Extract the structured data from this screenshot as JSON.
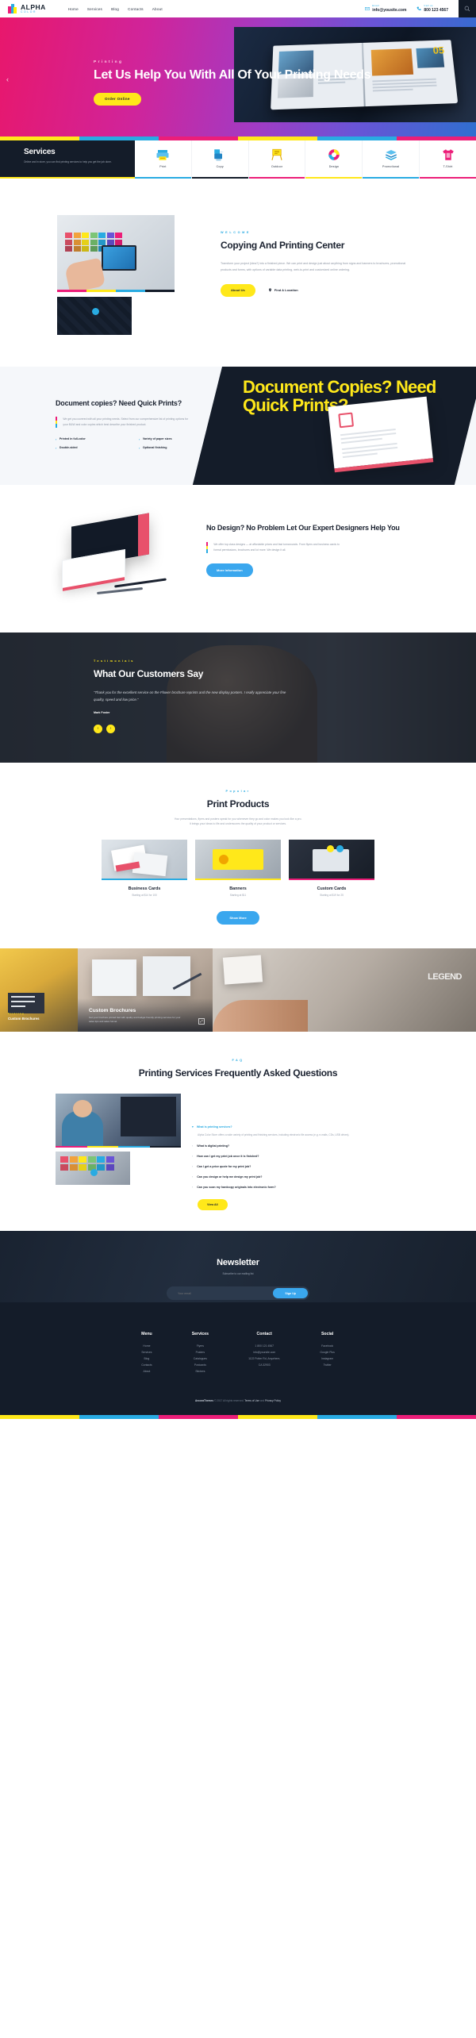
{
  "header": {
    "logo_title": "ALPHA",
    "logo_sub": "COLOR",
    "nav": [
      {
        "label": "Home"
      },
      {
        "label": "Services"
      },
      {
        "label": "Blog"
      },
      {
        "label": "Contacts"
      },
      {
        "label": "About"
      }
    ],
    "email_label": "Email",
    "email_value": "info@yousite.com",
    "phone_label": "Call us",
    "phone_value": "800 123 4567",
    "search_icon": "search-icon"
  },
  "hero": {
    "eyebrow": "Printing",
    "title": "Let Us Help You With All Of Your Printing Needs",
    "button": "Order Online",
    "prev_arrow": "‹",
    "book_number": "05"
  },
  "services": {
    "title": "Services",
    "subtitle": "Online and in store, you can find printing services to help you get the job done.",
    "items": [
      {
        "label": "Print",
        "icon": "printer-icon",
        "accent": "#29abe2"
      },
      {
        "label": "Copy",
        "icon": "copier-icon",
        "accent": "#141c29"
      },
      {
        "label": "Outdoor",
        "icon": "sign-board-icon",
        "accent": "#ec1e79"
      },
      {
        "label": "Design",
        "icon": "color-wheel-icon",
        "accent": "#ffe81a"
      },
      {
        "label": "Promotional",
        "icon": "stack-paper-icon",
        "accent": "#29abe2"
      },
      {
        "label": "T-Shirt",
        "icon": "tshirt-icon",
        "accent": "#ec1e79"
      }
    ]
  },
  "welcome": {
    "eyebrow": "Welcome",
    "title": "Copying And Printing Center",
    "paragraph": "Transform your project (idea?) into a finished piece. We can print and design just about anything from signs and banners to brochures, promotional products and forms, with options of variable data printing, web-to-print and customized online ordering.",
    "primary_button": "About Us",
    "secondary_link": "Find A Location",
    "location_icon": "map-pin-icon"
  },
  "document": {
    "title": "Document copies? Need Quick Prints?",
    "ghost_text": "Document Copies? Need Quick Prints?",
    "paragraph": "We get you covered with all your printing needs. Select from our comprehensive list of printing options for your B&W and color copies which best describe your finished product.",
    "features": [
      "Printed in full-color",
      "Variety of paper sizes",
      "Double-sided",
      "Optional finishing"
    ]
  },
  "design": {
    "title": "No Design? No Problem Let Our Expert Designers Help You",
    "paragraph": "We offer top class designs — at affordable prices and fast turnarounds. From flyers and business cards to formal permissions, brochures and lot more. We design it all.",
    "button": "More Information"
  },
  "testimonials": {
    "eyebrow": "Testimonials",
    "title": "What Our Customers Say",
    "quote": "“Thank you for the excellent service on the Flower brochure reprints and the new display posters. I really appreciate your fine quality, speed and low price.”",
    "author": "Mark Foster",
    "prev": "‹",
    "next": "›"
  },
  "products": {
    "eyebrow": "Popular",
    "title": "Print Products",
    "paragraph_line1": "Your presentations, flyers and posters speak for you whenever they go and color makes you look like a pro.",
    "paragraph_line2": "It brings your ideas to life and underscores the quality of your product or services.",
    "items": [
      {
        "name": "Business Cards",
        "price": "Starting at $14 for 100",
        "accent": "#29abe2"
      },
      {
        "name": "Banners",
        "price": "Starting at $11",
        "accent": "#ffe81a"
      },
      {
        "name": "Custom Cards",
        "price": "Starting at $19 for 25",
        "accent": "#ec1e79"
      }
    ],
    "button": "Show More"
  },
  "gallery": {
    "tile1_eyebrow": "Printing",
    "tile1_title": "Custom Brochures",
    "tile2_title": "Custom Brochures",
    "tile2_subtitle": "Get your brochure printed fast with quality and budget friendly printing services for your sales tips and sales funnel.",
    "expand_icon": "expand-icon",
    "tile3_text": "LEGEND"
  },
  "faq": {
    "eyebrow": "FAQ",
    "title": "Printing Services Frequently Asked Questions",
    "open_question": "What is printing services?",
    "open_answer": "Alpha Color Store offers a wide variety of printing and finishing services, including electronic file access (e.g. e-mails, CDs, USB drives).",
    "questions": [
      "What is digital printing?",
      "How can I get my print job once it is finished?",
      "Can I get a price quote for my print job?",
      "Can you design or help me design my print job?",
      "Can you scan my hardcopy originals into electronic form?"
    ],
    "button": "View All"
  },
  "newsletter": {
    "title": "Newsletter",
    "subtitle": "Subscribe to our mailing list",
    "placeholder": "Your email",
    "button": "Sign Up"
  },
  "footer": {
    "columns": [
      {
        "title": "Menu",
        "links": [
          "Home",
          "Services",
          "Blog",
          "Contacts",
          "About"
        ]
      },
      {
        "title": "Services",
        "links": [
          "Flyers",
          "Posters",
          "Catalogues",
          "Postcards",
          "Stickers"
        ]
      },
      {
        "title": "Contact",
        "links": [
          "1 800 121 4567",
          "info@yoursite.com",
          "1122 Potter Rd, Anywhere,",
          "CA 32903"
        ]
      },
      {
        "title": "Social",
        "links": [
          "Facebook",
          "Google Plus",
          "Instagram",
          "Twitter"
        ]
      }
    ],
    "copyright_brand": "AncoraThemes",
    "copyright_rest": "© 2017 All rights reserved.",
    "terms": "Terms of Use",
    "and": "and",
    "privacy": "Privacy Policy"
  },
  "colors": {
    "cyan": "#29abe2",
    "magenta": "#ec1e79",
    "yellow": "#ffe81a",
    "dark": "#141c29",
    "blue": "#3aa7ee"
  }
}
